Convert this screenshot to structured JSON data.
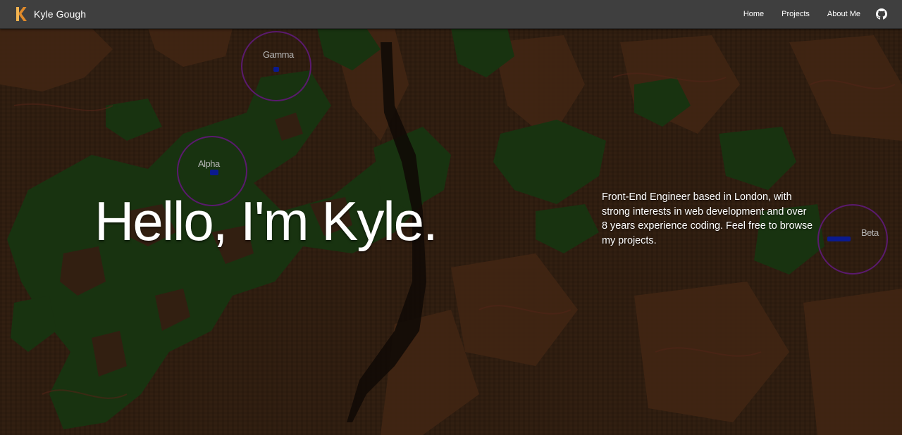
{
  "navbar": {
    "brand_name": "Kyle Gough",
    "links": [
      {
        "label": "Home"
      },
      {
        "label": "Projects"
      },
      {
        "label": "About Me"
      }
    ],
    "github_icon": "github-icon",
    "logo_icon": "k-logo-icon"
  },
  "hero": {
    "title": "Hello, I'm Kyle.",
    "description": "Front-End Engineer based in London, with strong interests in web development and over 8 years experience coding. Feel free to browse my projects."
  },
  "markers": [
    {
      "label": "Gamma"
    },
    {
      "label": "Alpha"
    },
    {
      "label": "Beta"
    }
  ],
  "colors": {
    "navbar": "#3f3f3f",
    "terrain_dirt": "#3a2414",
    "terrain_grass": "#1c3b13",
    "marker_ring": "#5a1a6e",
    "unit": "#0a1a8f",
    "logo_orange": "#e08a2a"
  }
}
